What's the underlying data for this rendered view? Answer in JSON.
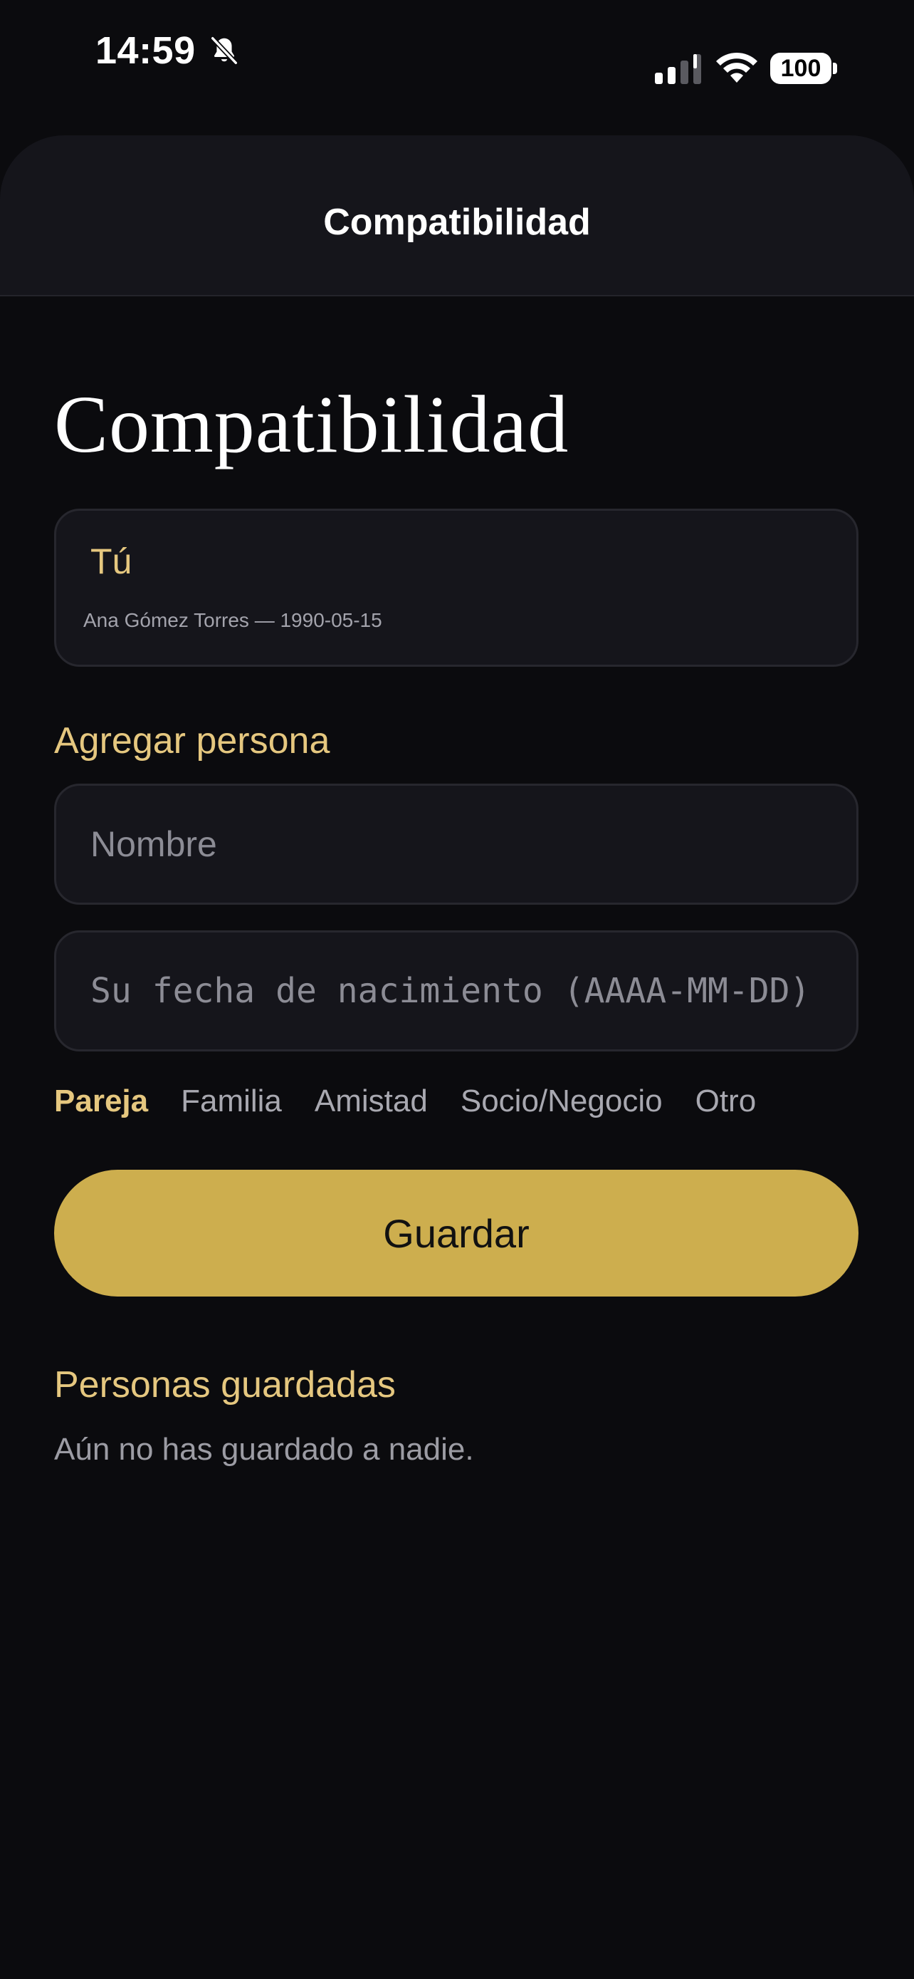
{
  "status_bar": {
    "time": "14:59",
    "battery": "100"
  },
  "header": {
    "title": "Compatibilidad"
  },
  "page": {
    "title": "Compatibilidad"
  },
  "user_card": {
    "label": "Tú",
    "detail": "Ana Gómez Torres — 1990-05-15"
  },
  "add_person": {
    "heading": "Agregar persona",
    "name_placeholder": "Nombre",
    "name_value": "",
    "date_placeholder": "Su fecha de nacimiento (AAAA-MM-DD)",
    "date_value": "",
    "relations": [
      {
        "label": "Pareja",
        "selected": true
      },
      {
        "label": "Familia",
        "selected": false
      },
      {
        "label": "Amistad",
        "selected": false
      },
      {
        "label": "Socio/Negocio",
        "selected": false
      },
      {
        "label": "Otro",
        "selected": false
      }
    ],
    "save_label": "Guardar"
  },
  "saved_people": {
    "heading": "Personas guardadas",
    "empty_message": "Aún no has guardado a nadie."
  },
  "colors": {
    "accent": "#e5c77f",
    "button": "#cdae4e",
    "background": "#0b0b0e",
    "card": "#15151b"
  },
  "icons": {
    "bell": "bell-slash-icon",
    "signal": "cellular-signal-icon",
    "wifi": "wifi-icon",
    "battery": "battery-icon"
  }
}
